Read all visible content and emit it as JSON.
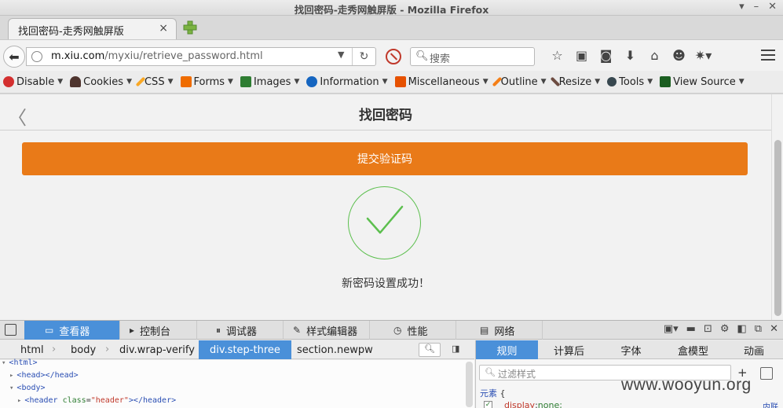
{
  "window": {
    "title": "找回密码-走秀网触屏版 - Mozilla Firefox",
    "controls": [
      "▾",
      "–",
      "✕"
    ]
  },
  "tab": {
    "title": "找回密码-走秀网触屏版",
    "close": "×"
  },
  "newtab": {
    "symbol": "+"
  },
  "navbar": {
    "url_host": "m.xiu.com",
    "url_path": "/myxiu/retrieve_password.html",
    "search_placeholder": "搜索",
    "icons": [
      "bookmark-star-icon",
      "reading-list-icon",
      "pocket-icon",
      "downloads-icon",
      "home-icon",
      "emoji-icon",
      "extension-icon"
    ]
  },
  "devtoolbar": {
    "items": [
      {
        "label": "Disable",
        "icon": "disable-icon",
        "color": "#d32f2f"
      },
      {
        "label": "Cookies",
        "icon": "cookies-icon",
        "color": "#4e342e"
      },
      {
        "label": "CSS",
        "icon": "css-icon",
        "color": "#f9a825"
      },
      {
        "label": "Forms",
        "icon": "forms-icon",
        "color": "#ef6c00"
      },
      {
        "label": "Images",
        "icon": "images-icon",
        "color": "#2e7d32"
      },
      {
        "label": "Information",
        "icon": "information-icon",
        "color": "#1565c0"
      },
      {
        "label": "Miscellaneous",
        "icon": "miscellaneous-icon",
        "color": "#e65100"
      },
      {
        "label": "Outline",
        "icon": "outline-icon",
        "color": "#f57f17"
      },
      {
        "label": "Resize",
        "icon": "resize-icon",
        "color": "#6d4c41"
      },
      {
        "label": "Tools",
        "icon": "tools-icon",
        "color": "#37474f"
      },
      {
        "label": "View Source",
        "icon": "view-source-icon",
        "color": "#1b5e20"
      }
    ]
  },
  "page": {
    "title": "找回密码",
    "back_symbol": "〈",
    "submit_label": "提交验证码",
    "success_text": "新密码设置成功！",
    "accent_color": "#e97a18",
    "success_color": "#5cbf4e"
  },
  "devtools": {
    "tabs": [
      {
        "label": "查看器",
        "icon": "inspector-icon",
        "glyph": "▭"
      },
      {
        "label": "控制台",
        "icon": "console-icon",
        "glyph": "▸"
      },
      {
        "label": "调试器",
        "icon": "debugger-icon",
        "glyph": "⏸"
      },
      {
        "label": "样式编辑器",
        "icon": "style-editor-icon",
        "glyph": "✎"
      },
      {
        "label": "性能",
        "icon": "performance-icon",
        "glyph": "◷"
      },
      {
        "label": "网络",
        "icon": "network-icon",
        "glyph": "▤"
      }
    ],
    "breadcrumbs": [
      "html",
      "body",
      "div.wrap-verify",
      "div.step-three",
      "section.newpw"
    ],
    "markup": {
      "l1": "<html>",
      "l2_open": "<head>",
      "l2_close": "</head>",
      "l3": "<body>",
      "l4_tag_open": "<header ",
      "l4_attr": "class",
      "l4_val": "\"header\"",
      "l4_tag_close": "></header>"
    },
    "side_tabs": [
      "规则",
      "计算后",
      "字体",
      "盒模型",
      "动画"
    ],
    "filter_placeholder": "过滤样式",
    "rule": {
      "selector": "元素",
      "brace": " {",
      "property": "display",
      "value": "none;",
      "source": "内联"
    }
  },
  "watermark": "www.wooyun.org"
}
